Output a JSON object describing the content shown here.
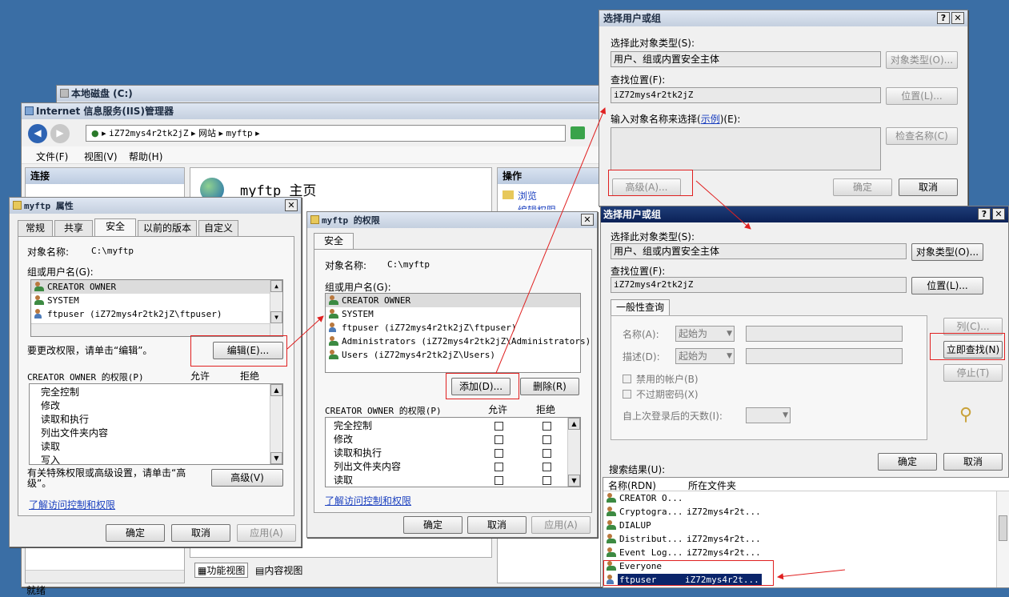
{
  "disk_window": {
    "title": "本地磁盘 (C:)"
  },
  "iis": {
    "title": "Internet 信息服务(IIS)管理器",
    "breadcrumb": [
      "iZ72mys4r2tk2jZ",
      "网站",
      "myftp"
    ],
    "menu": [
      "文件(F)",
      "视图(V)",
      "帮助(H)"
    ],
    "connections_label": "连接",
    "home_title": "myftp 主页",
    "actions_label": "操作",
    "actions": [
      "浏览",
      "编辑权限..."
    ],
    "features_view": "功能视图",
    "content_view": "内容视图",
    "status": "就绪"
  },
  "props": {
    "title": "myftp 属性",
    "tabs": [
      "常规",
      "共享",
      "安全",
      "以前的版本",
      "自定义"
    ],
    "object_name_label": "对象名称:",
    "object_name": "C:\\myftp",
    "group_label": "组或用户名(G):",
    "users": [
      "CREATOR OWNER",
      "SYSTEM",
      "ftpuser (iZ72mys4r2tk2jZ\\ftpuser)"
    ],
    "change_hint": "要更改权限，请单击“编辑”。",
    "edit_button": "编辑(E)...",
    "perm_label": "CREATOR OWNER 的权限(P)",
    "allow": "允许",
    "deny": "拒绝",
    "perms": [
      "完全控制",
      "修改",
      "读取和执行",
      "列出文件夹内容",
      "读取",
      "写入"
    ],
    "advanced_hint": "有关特殊权限或高级设置，请单击“高级”。",
    "advanced_button": "高级(V)",
    "learn_link": "了解访问控制和权限",
    "ok": "确定",
    "cancel": "取消",
    "apply": "应用(A)"
  },
  "perm": {
    "title": "myftp 的权限",
    "tab": "安全",
    "object_name_label": "对象名称:",
    "object_name": "C:\\myftp",
    "group_label": "组或用户名(G):",
    "users": [
      "CREATOR OWNER",
      "SYSTEM",
      "ftpuser (iZ72mys4r2tk2jZ\\ftpuser)",
      "Administrators (iZ72mys4r2tk2jZ\\Administrators)",
      "Users (iZ72mys4r2tk2jZ\\Users)"
    ],
    "add_button": "添加(D)...",
    "remove_button": "删除(R)",
    "perm_label": "CREATOR OWNER 的权限(P)",
    "allow": "允许",
    "deny": "拒绝",
    "perms": [
      "完全控制",
      "修改",
      "读取和执行",
      "列出文件夹内容",
      "读取"
    ],
    "learn_link": "了解访问控制和权限",
    "ok": "确定",
    "cancel": "取消",
    "apply": "应用(A)"
  },
  "sel1": {
    "title": "选择用户或组",
    "type_label": "选择此对象类型(S):",
    "type_value": "用户、组或内置安全主体",
    "type_button": "对象类型(O)...",
    "loc_label": "查找位置(F):",
    "loc_value": "iZ72mys4r2tk2jZ",
    "loc_button": "位置(L)...",
    "name_label_a": "输入对象名称来选择(",
    "name_link": "示例",
    "name_label_b": ")(E):",
    "check_button": "检查名称(C)",
    "advanced_button": "高级(A)...",
    "ok": "确定",
    "cancel": "取消"
  },
  "sel2": {
    "title": "选择用户或组",
    "type_label": "选择此对象类型(S):",
    "type_value": "用户、组或内置安全主体",
    "type_button": "对象类型(O)...",
    "loc_label": "查找位置(F):",
    "loc_value": "iZ72mys4r2tk2jZ",
    "loc_button": "位置(L)...",
    "query_tab": "一般性查询",
    "name_label": "名称(A):",
    "desc_label": "描述(D):",
    "starts_with": "起始为",
    "columns_button": "列(C)...",
    "find_button": "立即查找(N)",
    "stop_button": "停止(T)",
    "disabled_accounts": "禁用的帐户(B)",
    "non_expiring": "不过期密码(X)",
    "days_label": "自上次登录后的天数(I):",
    "ok": "确定",
    "cancel": "取消",
    "results_label": "搜索结果(U):",
    "col_name": "名称(RDN)",
    "col_folder": "所在文件夹",
    "results": [
      {
        "name": "CREATOR O...",
        "folder": ""
      },
      {
        "name": "Cryptogra...",
        "folder": "iZ72mys4r2t..."
      },
      {
        "name": "DIALUP",
        "folder": ""
      },
      {
        "name": "Distribut...",
        "folder": "iZ72mys4r2t..."
      },
      {
        "name": "Event Log...",
        "folder": "iZ72mys4r2t..."
      },
      {
        "name": "Everyone",
        "folder": ""
      },
      {
        "name": "ftpuser",
        "folder": "iZ72mys4r2t..."
      }
    ]
  },
  "colors": {
    "highlight": "#e02020",
    "selection": "#0a246a",
    "desktop": "#3a6ea5"
  }
}
